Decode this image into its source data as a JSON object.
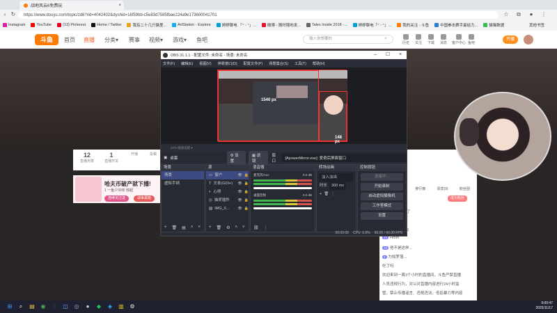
{
  "browser": {
    "tab_title": "战地风云6免费玩",
    "url": "https://www.douyu.com/topic/zd6?rid=4042402&dyshid=16f59bb-c5e83d7585fbae224a9e173600041701",
    "bookmarks": [
      {
        "label": "Instagram",
        "color": "#d6249f"
      },
      {
        "label": "YouTube",
        "color": "#ff0000"
      },
      {
        "label": "(13) Pinterest",
        "color": "#e60023"
      },
      {
        "label": "Home / Twitter",
        "color": "#111111"
      },
      {
        "label": "我有二十几只猫里...",
        "color": "#f0a020"
      },
      {
        "label": "ArtStation - Explore",
        "color": "#13aff0"
      },
      {
        "label": "婷婷聊电 「ᐢ˙ᵕ˙ᐢ」...",
        "color": "#00a1d6"
      },
      {
        "label": "微博 - 随时随地发...",
        "color": "#e6162d"
      },
      {
        "label": "Tales Inside 2018 -...",
        "color": "#666666"
      },
      {
        "label": "婷婷聊电「ᐢ˙ᵕ˙ᐢ」...",
        "color": "#00a1d6"
      },
      {
        "label": "我的关注 - 斗鱼",
        "color": "#ff7a00"
      },
      {
        "label": "中国拳击赛手最给力...",
        "color": "#2b7bd6"
      },
      {
        "label": "猫猫数据",
        "color": "#3cba54"
      }
    ],
    "other_bookmarks": "其他书签"
  },
  "site": {
    "logo": "斗鱼",
    "nav": [
      "首页",
      "直播",
      "分类▾",
      "赛事",
      "视频▾",
      "游戏▾",
      "鱼吧"
    ],
    "search_placeholder": "输入你想要的",
    "header_icons": [
      "历史",
      "关注",
      "下载",
      "消息",
      "客户中心",
      "鱼吧"
    ],
    "open_btn": "开播",
    "stats": [
      {
        "value": "12",
        "label": "直播天数"
      },
      {
        "value": "1",
        "label": "直播开关"
      },
      {
        "value": "",
        "label": "开播"
      },
      {
        "value": "",
        "label": "投稿"
      }
    ],
    "banner_title": "哈夫币破产就下播!",
    "banner_sub": "1 一鱼少30年 收起",
    "banner_btns": [
      "连续关注送",
      "战争黑暗"
    ],
    "chat_tabs": [
      "排行榜",
      "贵宾(9)",
      "粉丝团"
    ],
    "achievement_btn": "成为粉丝",
    "chat_lines": [
      {
        "badge": "今日开播",
        "text": "开播了"
      },
      {
        "badge": "",
        "text": "抽卡记录"
      },
      {
        "badge": "25",
        "text": "曼曼飞哪去"
      },
      {
        "badge": "23",
        "text": "Hmm"
      },
      {
        "badge": "23",
        "text": "他不是这样..."
      },
      {
        "badge": "5",
        "text": "为知罗落..."
      },
      {
        "badge": "",
        "text": "吃了吗"
      },
      {
        "badge": "",
        "text": "欢迎来到一首3个小时的直播间，斗鱼严禁直播"
      },
      {
        "badge": "",
        "text": "人员违规行为，对以对直播内容进行24小时监"
      },
      {
        "badge": "",
        "text": "管，禁止传播谣言、违规违法、低俗暴力等内容"
      }
    ]
  },
  "obs": {
    "title": "OBS 31.1.1 - 配置文件: 未命名 - 场景: 未命名",
    "menu": [
      "文件(F)",
      "编辑(E)",
      "视图(V)",
      "停靠窗口(D)",
      "配置文件(P)",
      "场景集合(S)",
      "工具(T)",
      "帮助(H)"
    ],
    "preview_labels": {
      "w": "1540 px",
      "h": "148 px"
    },
    "controls_text": "22%  缩放适配 ▾",
    "source_name": "桌幕",
    "buttons": {
      "properties": "设置",
      "filters": "滤镜"
    },
    "window_label": "窗口",
    "window_value": "[ApowerMirror.exe]: 爱奇后屏面窗口",
    "docks": {
      "scenes": {
        "title": "场景",
        "items": [
          "场景",
          "虚拟手柄"
        ]
      },
      "sources": {
        "title": "源",
        "items": [
          "窗户",
          "文本(GDI+)",
          "心得",
          "抽奖插件",
          "IMG_0..."
        ]
      },
      "mixer": {
        "title": "混音器",
        "tracks": [
          {
            "name": "麦克风/Aux",
            "db": "0.0 dB"
          },
          {
            "name": "桌面音频",
            "db": "0.0 dB"
          }
        ]
      },
      "transitions": {
        "title": "转场动画",
        "type": "淡入淡出",
        "duration_label": "时长",
        "duration": "300 ms"
      },
      "controls": {
        "title": "控制按钮",
        "buttons": [
          "开始直播",
          "开始录制",
          "启动虚拟摄像机",
          "工作室模式",
          "设置",
          "退出"
        ],
        "live_disabled": "连接中..."
      }
    },
    "status": {
      "cpu": "CPU: 0.6%",
      "fps": "60.00 / 60.00 FPS",
      "rec": "00:00:00"
    }
  },
  "taskbar": {
    "time": "9:00:47",
    "date": "2025/11/17",
    "apps": [
      "start",
      "search",
      "files",
      "chrome",
      "edge",
      "store",
      "steam",
      "obs",
      "game",
      "photo",
      "files2",
      "settings"
    ]
  }
}
